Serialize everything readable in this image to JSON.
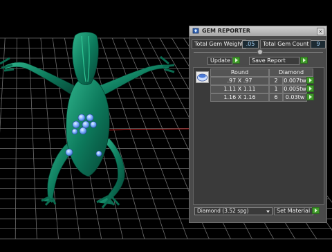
{
  "panel": {
    "title": "GEM REPORTER",
    "close_glyph": "×",
    "total_gem_weight_label": "Total Gem Weight",
    "total_gem_weight_value": ".05",
    "total_gem_count_label": "Total Gem Count",
    "total_gem_count_value": "9",
    "update_label": "Update",
    "save_report_label": "Save Report",
    "table": {
      "col_shape": "Round",
      "col_material": "Diamond",
      "rows": [
        {
          "size": ".97 X .97",
          "count": "2",
          "weight": "0.007tw"
        },
        {
          "size": "1.11 X 1.11",
          "count": "1",
          "weight": "0.005tw"
        },
        {
          "size": "1.16 X 1.16",
          "count": "6",
          "weight": "0.03tw"
        }
      ]
    },
    "material_select_value": "Diamond      (3.52 spg)",
    "set_material_label": "Set Material"
  },
  "colors": {
    "accent_green": "#3f9a2a",
    "value_blue": "#a9d8ff",
    "frog_green": "#0d7a5c",
    "gem_blue": "#6aa6ff"
  },
  "icons": {
    "title": "gem-reporter-app-icon",
    "close": "close-icon",
    "gem": "round-gem-icon"
  }
}
